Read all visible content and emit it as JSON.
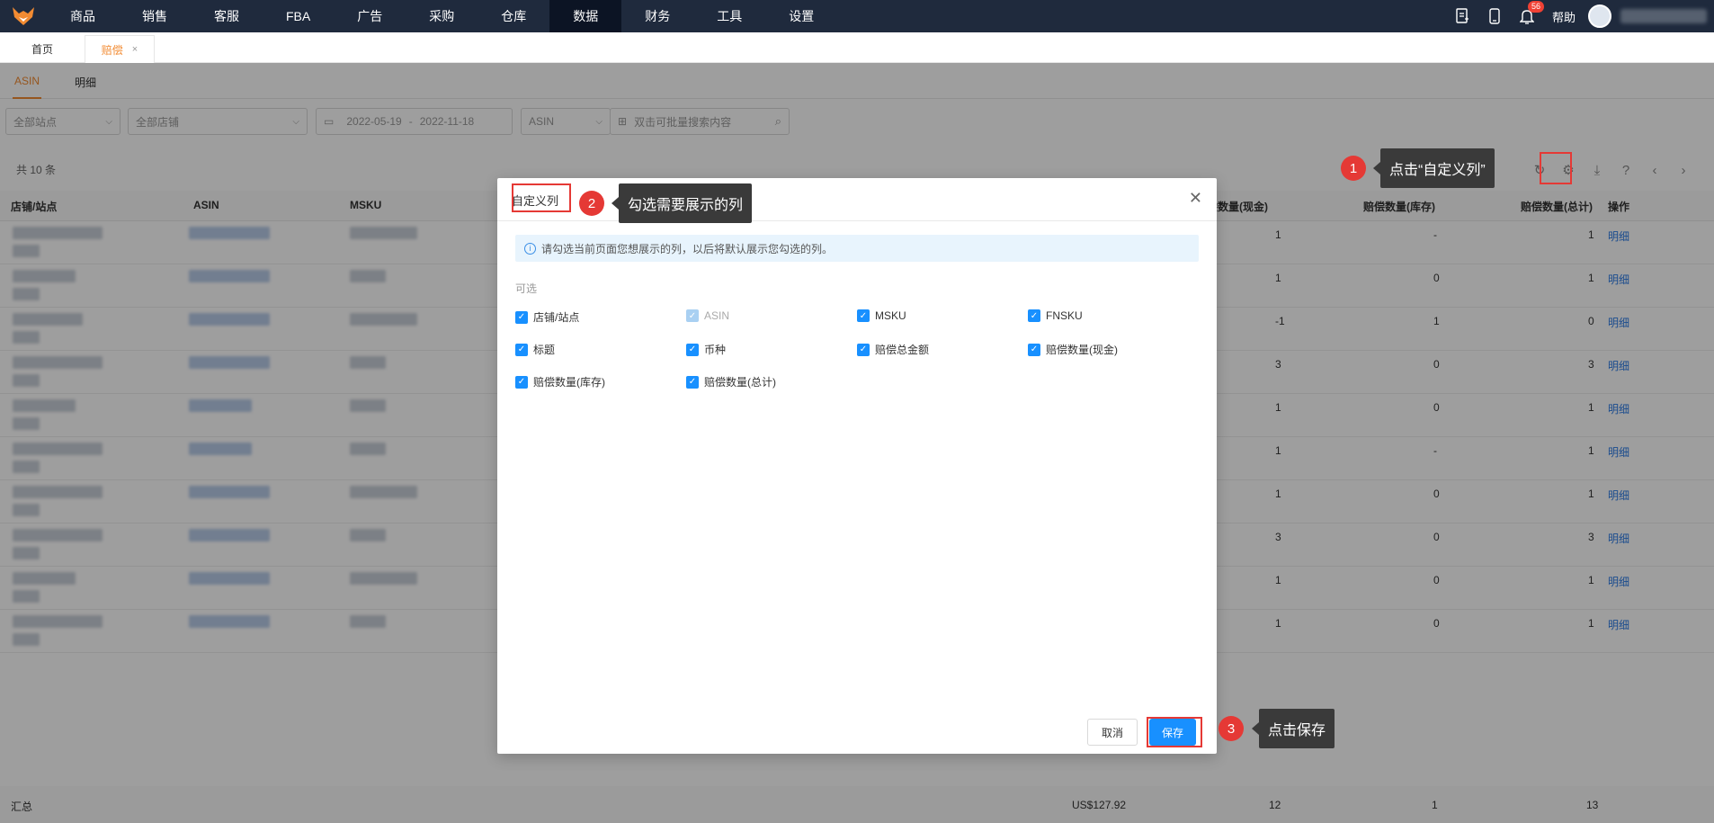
{
  "nav": {
    "items": [
      "商品",
      "销售",
      "客服",
      "FBA",
      "广告",
      "采购",
      "仓库",
      "数据",
      "财务",
      "工具",
      "设置"
    ],
    "active_index": 7,
    "notification_count": "56",
    "help": "帮助"
  },
  "tabs": {
    "home": "首页",
    "current": "赔偿",
    "close": "×"
  },
  "subtabs": {
    "asin": "ASIN",
    "detail": "明细"
  },
  "filters": {
    "site": "全部站点",
    "store": "全部店铺",
    "date_start": "2022-05-19",
    "date_sep": "-",
    "date_end": "2022-11-18",
    "search_type": "ASIN",
    "search_placeholder": "双击可批量搜索内容"
  },
  "table": {
    "count_text": "共 10 条",
    "headers": {
      "store_site": "店铺/站点",
      "asin": "ASIN",
      "msku": "MSKU",
      "cash": "赔偿数量(现金)",
      "inventory": "赔偿数量(库存)",
      "total": "赔偿数量(总计)",
      "action": "操作"
    },
    "rows": [
      {
        "cash": "1",
        "inventory": "-",
        "total": "1",
        "action": "明细"
      },
      {
        "cash": "1",
        "inventory": "0",
        "total": "1",
        "action": "明细"
      },
      {
        "cash": "-1",
        "inventory": "1",
        "total": "0",
        "action": "明细"
      },
      {
        "cash": "3",
        "inventory": "0",
        "total": "3",
        "action": "明细"
      },
      {
        "cash": "1",
        "inventory": "0",
        "total": "1",
        "action": "明细"
      },
      {
        "cash": "1",
        "inventory": "-",
        "total": "1",
        "action": "明细"
      },
      {
        "cash": "1",
        "inventory": "0",
        "total": "1",
        "action": "明细"
      },
      {
        "cash": "3",
        "inventory": "0",
        "total": "3",
        "action": "明细"
      },
      {
        "cash": "1",
        "inventory": "0",
        "total": "1",
        "action": "明细"
      },
      {
        "cash": "1",
        "inventory": "0",
        "total": "1",
        "action": "明细"
      }
    ],
    "summary": {
      "label": "汇总",
      "amount": "US$127.92",
      "cash": "12",
      "inventory": "1",
      "total": "13"
    }
  },
  "dialog": {
    "title": "自定义列",
    "notice": "请勾选当前页面您想展示的列，以后将默认展示您勾选的列。",
    "optional_label": "可选",
    "options": [
      {
        "label": "店铺/站点",
        "checked": true,
        "disabled": false
      },
      {
        "label": "ASIN",
        "checked": true,
        "disabled": true
      },
      {
        "label": "MSKU",
        "checked": true,
        "disabled": false
      },
      {
        "label": "FNSKU",
        "checked": true,
        "disabled": false
      },
      {
        "label": "标题",
        "checked": true,
        "disabled": false
      },
      {
        "label": "币种",
        "checked": true,
        "disabled": false
      },
      {
        "label": "赔偿总金额",
        "checked": true,
        "disabled": false
      },
      {
        "label": "赔偿数量(现金)",
        "checked": true,
        "disabled": false
      },
      {
        "label": "赔偿数量(库存)",
        "checked": true,
        "disabled": false
      },
      {
        "label": "赔偿数量(总计)",
        "checked": true,
        "disabled": false
      }
    ],
    "cancel": "取消",
    "save": "保存"
  },
  "annotations": [
    {
      "num": "1",
      "text": "点击“自定义列”"
    },
    {
      "num": "2",
      "text": "勾选需要展示的列"
    },
    {
      "num": "3",
      "text": "点击保存"
    }
  ],
  "colors": {
    "accent": "#f28b32",
    "primary": "#1890ff",
    "annotation_red": "#e53935",
    "nav_bg": "#1f2a3d"
  }
}
